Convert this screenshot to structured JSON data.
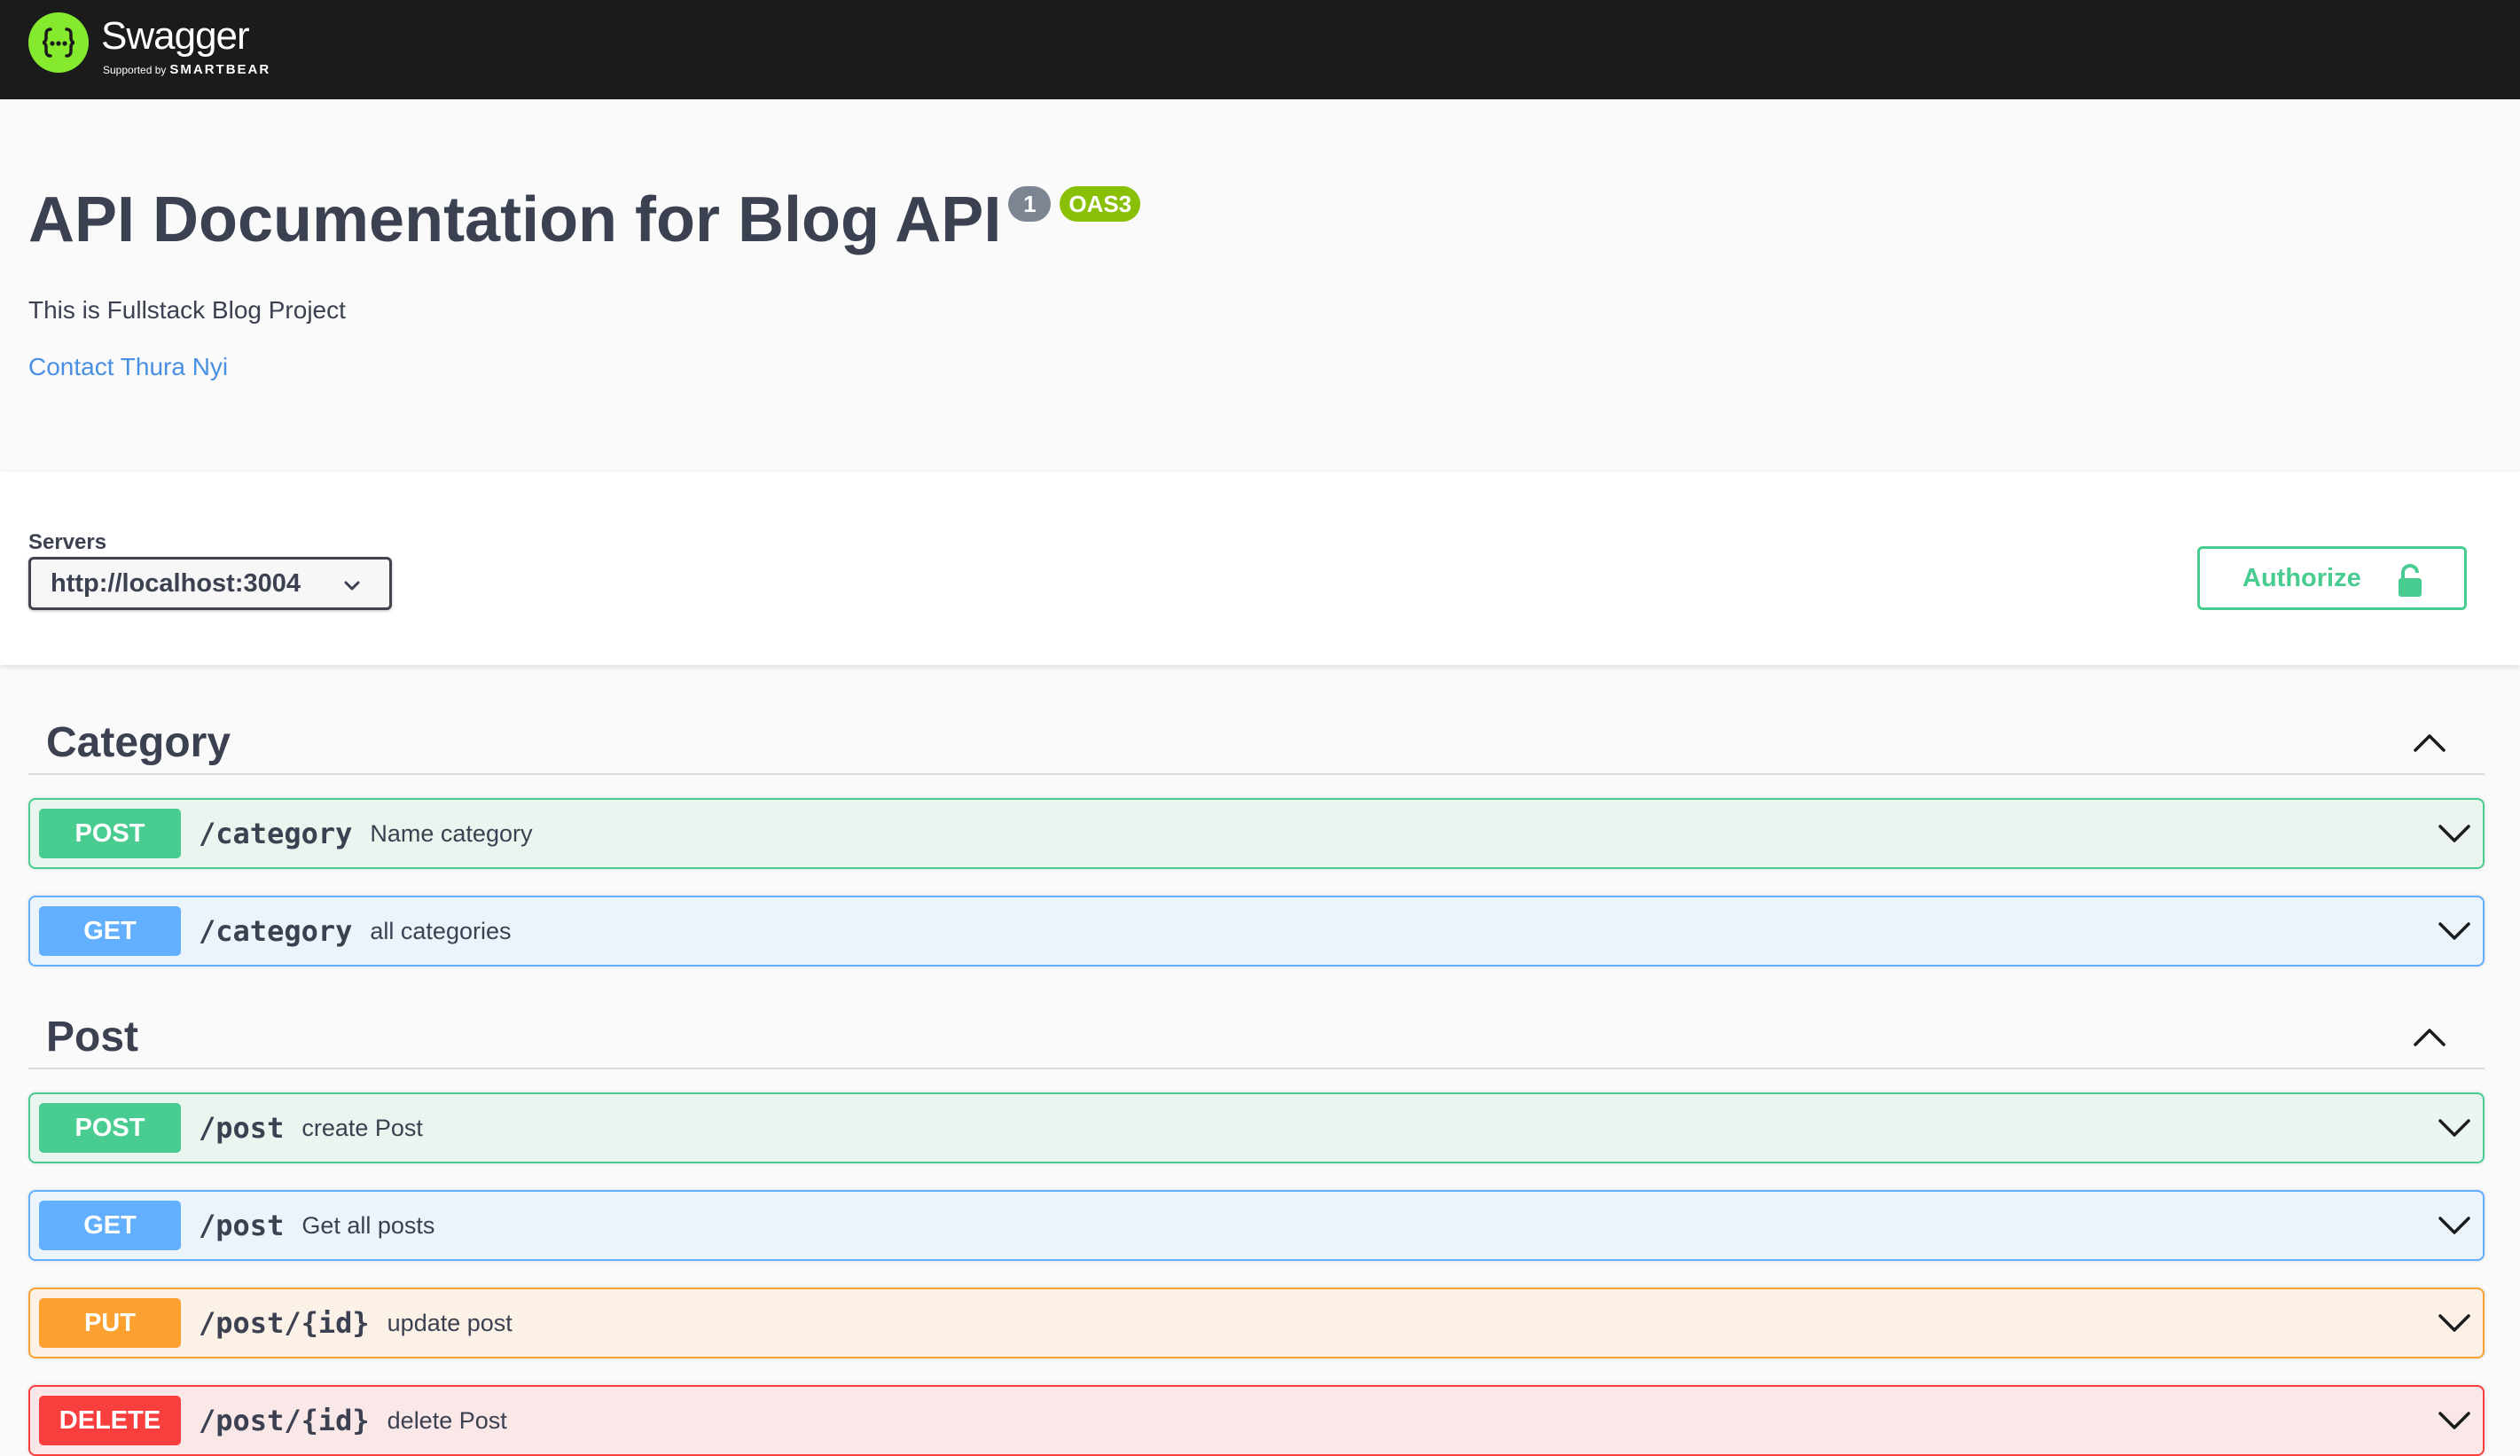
{
  "topbar": {
    "logo_name": "Swagger",
    "logo_supported_by": "Supported by",
    "logo_brand": "SMARTBEAR",
    "logo_icon": "swagger-braces-icon"
  },
  "info": {
    "title": "API Documentation for Blog API",
    "version": "1",
    "oas_badge": "OAS3",
    "description": "This is Fullstack Blog Project",
    "contact": "Contact Thura Nyi"
  },
  "schemes": {
    "servers_label": "Servers",
    "selected_server": "http://localhost:3004",
    "authorize_label": "Authorize"
  },
  "tags": [
    {
      "name": "Category",
      "operations": [
        {
          "method": "POST",
          "path": "/category",
          "summary": "Name category"
        },
        {
          "method": "GET",
          "path": "/category",
          "summary": "all categories"
        }
      ]
    },
    {
      "name": "Post",
      "operations": [
        {
          "method": "POST",
          "path": "/post",
          "summary": "create Post"
        },
        {
          "method": "GET",
          "path": "/post",
          "summary": "Get all posts"
        },
        {
          "method": "PUT",
          "path": "/post/{id}",
          "summary": "update post"
        },
        {
          "method": "DELETE",
          "path": "/post/{id}",
          "summary": "delete Post"
        }
      ]
    }
  ],
  "colors": {
    "topbar": "#1b1b1b",
    "logo": "#85ea2d",
    "post": "#49cc90",
    "get": "#61affe",
    "put": "#fca130",
    "delete": "#f93e3e",
    "link": "#4990e2",
    "oas": "#89bf04"
  }
}
